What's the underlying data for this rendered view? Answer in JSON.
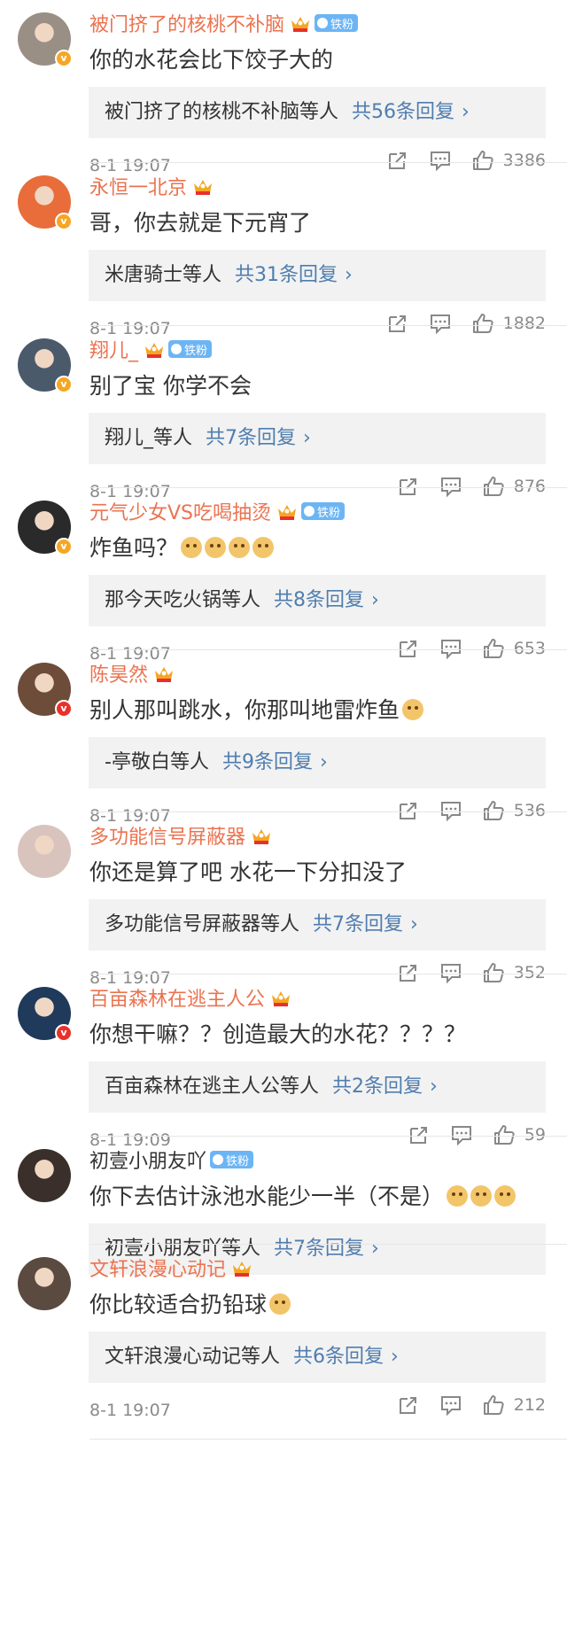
{
  "comments": [
    {
      "user": "被门挤了的核桃不补脑",
      "crown": true,
      "fan": true,
      "text": "你的水花会比下饺子大的",
      "emoji_count": 0,
      "reply_user": "被门挤了的核桃不补脑等人",
      "reply_count": "共56条回复",
      "time": "8-1 19:07",
      "likes": "3386",
      "avatar": "#9a8f85",
      "badge": "gold"
    },
    {
      "user": "永恒一北京",
      "crown": true,
      "fan": false,
      "text": "哥，你去就是下元宵了",
      "emoji_count": 0,
      "reply_user": "米唐骑士等人",
      "reply_count": "共31条回复",
      "time": "8-1 19:07",
      "likes": "1882",
      "avatar": "#e86d3a",
      "badge": "gold"
    },
    {
      "user": "翔儿_",
      "crown": true,
      "fan": true,
      "text": "别了宝 你学不会",
      "emoji_count": 0,
      "reply_user": "翔儿_等人",
      "reply_count": "共7条回复",
      "time": "8-1 19:07",
      "likes": "876",
      "avatar": "#4a5a6a",
      "badge": "gold"
    },
    {
      "user": "元气少女VS吃喝抽烫",
      "crown": true,
      "fan": true,
      "text": "炸鱼吗？",
      "emoji_count": 4,
      "reply_user": "那今天吃火锅等人",
      "reply_count": "共8条回复",
      "time": "8-1 19:07",
      "likes": "653",
      "avatar": "#2a2a2a",
      "badge": "gold"
    },
    {
      "user": "陈昊然",
      "crown": true,
      "fan": false,
      "text": "别人那叫跳水，你那叫地雷炸鱼",
      "emoji_count": 1,
      "reply_user": "-亭敬白等人",
      "reply_count": "共9条回复",
      "time": "8-1 19:07",
      "likes": "536",
      "avatar": "#6d4c3a",
      "badge": "red"
    },
    {
      "user": "多功能信号屏蔽器",
      "crown": true,
      "fan": false,
      "text": "你还是算了吧 水花一下分扣没了",
      "emoji_count": 0,
      "reply_user": "多功能信号屏蔽器等人",
      "reply_count": "共7条回复",
      "time": "8-1 19:07",
      "likes": "352",
      "avatar": "#d8c4bc",
      "badge": "none"
    },
    {
      "user": "百亩森林在逃主人公",
      "crown": true,
      "fan": false,
      "text": "你想干嘛？？创造最大的水花？？？？",
      "emoji_count": 0,
      "reply_user": "百亩森林在逃主人公等人",
      "reply_count": "共2条回复",
      "time": "8-1 19:09",
      "likes": "59",
      "avatar": "#1f3a5a",
      "badge": "red"
    },
    {
      "user": "初壹小朋友吖",
      "crown": false,
      "fan": true,
      "text": "你下去估计泳池水能少一半（不是）",
      "emoji_count": 3,
      "reply_user": "初壹小朋友吖等人",
      "reply_count": "共7条回复",
      "time": "",
      "likes": "",
      "avatar": "#3a2f2a",
      "badge": "none"
    },
    {
      "user": "文轩浪漫心动记",
      "crown": true,
      "fan": false,
      "text": "你比较适合扔铅球",
      "emoji_count": 1,
      "reply_user": "文轩浪漫心动记等人",
      "reply_count": "共6条回复",
      "time": "8-1 19:07",
      "likes": "212",
      "avatar": "#5a4a40",
      "badge": "none"
    }
  ],
  "labels": {
    "fan_badge": "铁粉",
    "chevron": "›"
  },
  "colors": {
    "username": "#eb7350",
    "link": "#507daf",
    "reply_bg": "#f2f2f2"
  }
}
